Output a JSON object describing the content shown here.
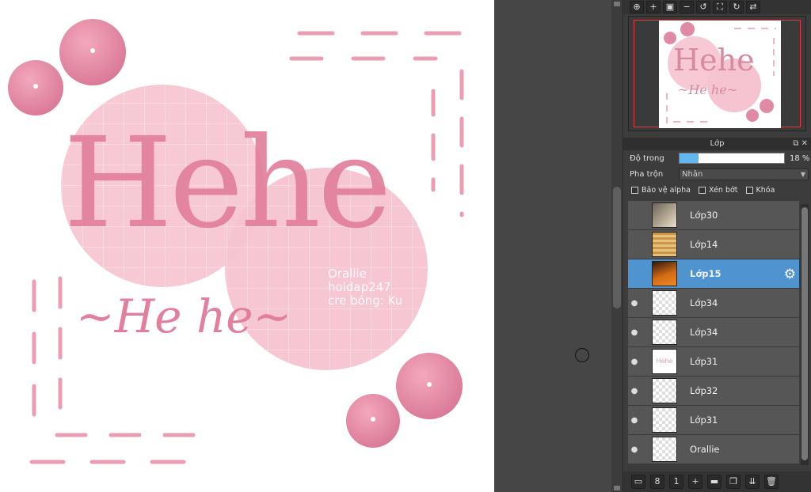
{
  "canvas": {
    "title_text": "Hehe",
    "subtitle_text": "~He he~",
    "credit_lines": [
      "Orallie",
      "hoidap247",
      "cre bóng: Ku"
    ],
    "colors": {
      "pink_light": "#f7c9d5",
      "pink_text": "#e27f9d",
      "pink_dark": "#d96f8e"
    }
  },
  "navigator": {
    "tools": [
      "zoom-to-fit-icon",
      "zoom-in-icon",
      "fit-screen-icon",
      "zoom-out-icon",
      "rotate-left-icon",
      "fullscreen-icon",
      "rotate-right-icon",
      "flip-icon"
    ],
    "mini_title": "Hehe",
    "mini_subtitle": "~He he~"
  },
  "layers_panel": {
    "header": "Lớp",
    "opacity_label": "Độ trong",
    "opacity_percent": 18,
    "opacity_text": "18 %",
    "blend_label": "Pha trộn",
    "blend_value": "Nhân",
    "checks": {
      "protect_alpha": "Bảo vệ alpha",
      "clip": "Xén bớt",
      "lock": "Khóa"
    },
    "layers": [
      {
        "name": "Lớp30",
        "visible": false,
        "thumb": "photo1",
        "selected": false
      },
      {
        "name": "Lớp14",
        "visible": false,
        "thumb": "photo2",
        "selected": false
      },
      {
        "name": "Lớp15",
        "visible": false,
        "thumb": "photo3",
        "selected": true
      },
      {
        "name": "Lớp34",
        "visible": true,
        "thumb": "transparent",
        "selected": false
      },
      {
        "name": "Lớp34",
        "visible": true,
        "thumb": "transparent",
        "selected": false
      },
      {
        "name": "Lớp31",
        "visible": true,
        "thumb": "hehe",
        "selected": false
      },
      {
        "name": "Lớp32",
        "visible": true,
        "thumb": "transparent",
        "selected": false
      },
      {
        "name": "Lớp31",
        "visible": true,
        "thumb": "transparent",
        "selected": false
      },
      {
        "name": "Orallie",
        "visible": true,
        "thumb": "transparent",
        "selected": false
      }
    ],
    "thumb_hehe_text": "Hehe",
    "bottom_tools": [
      "new-layer-icon",
      "new-raster-icon",
      "new-1bit-icon",
      "add-layer-menu-icon",
      "folder-icon",
      "duplicate-icon",
      "merge-down-icon",
      "delete-icon"
    ]
  }
}
